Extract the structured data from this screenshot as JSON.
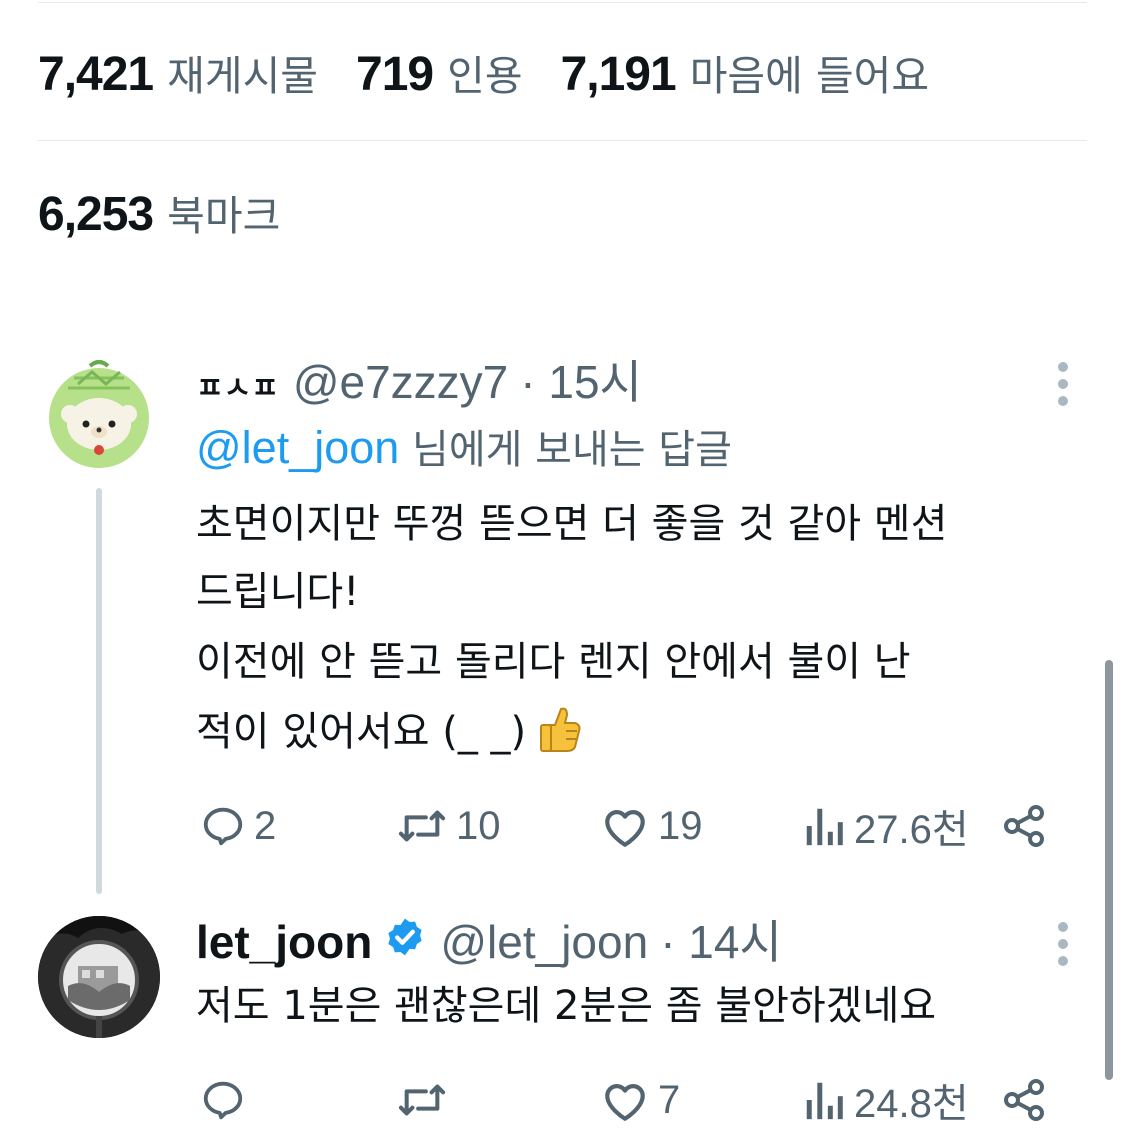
{
  "stats": {
    "reposts": {
      "value": "7,421",
      "label": "재게시물"
    },
    "quotes": {
      "value": "719",
      "label": "인용"
    },
    "likes": {
      "value": "7,191",
      "label": "마음에 들어요"
    },
    "bookmarks": {
      "value": "6,253",
      "label": "북마크"
    }
  },
  "reply1": {
    "display_name": "ㅍㅅㅍ",
    "handle": "@e7zzzy7",
    "time": "· 15시",
    "reply_to": {
      "mention": "@let_joon",
      "suffix": " 님에게 보내는 답글"
    },
    "lines": [
      "초면이지만 뚜껑 뜯으면 더 좋을 것 같아 멘션",
      "드립니다!",
      "이전에 안 뜯고 돌리다 렌지 안에서 불이 난",
      "적이 있어서요 (_ _)"
    ],
    "emoji": "👍",
    "metrics": {
      "replies": "2",
      "reposts": "10",
      "likes": "19",
      "views": "27.6천"
    }
  },
  "reply2": {
    "display_name": "let_joon",
    "handle": "@let_joon",
    "time": "· 14시",
    "text": "저도 1분은 괜찮은데 2분은 좀 불안하겠네요",
    "metrics": {
      "replies": "",
      "reposts": "",
      "likes": "7",
      "views": "24.8천"
    }
  },
  "colors": {
    "accent": "#1d9bf0",
    "secondary_text": "#536471",
    "primary_text": "#0f1419",
    "verified": "#1d9bf0"
  }
}
